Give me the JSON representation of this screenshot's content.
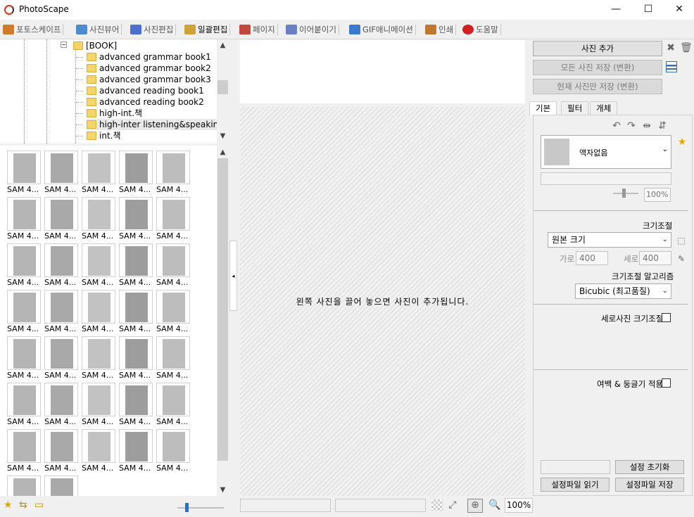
{
  "window": {
    "title": "PhotoScape",
    "minimize": "—",
    "maximize": "☐",
    "close": "✕"
  },
  "menu_tabs": [
    {
      "label": "포토스케이프",
      "color": "#d07a2a"
    },
    {
      "label": "사진뷰어",
      "color": "#4c8bd0"
    },
    {
      "label": "사진편집",
      "color": "#4c6fd0"
    },
    {
      "label": "일괄편집",
      "color": "#d0a23a"
    },
    {
      "label": "페이지",
      "color": "#c0483c"
    },
    {
      "label": "이어붙이기",
      "color": "#6a7fc4"
    },
    {
      "label": "GIF애니메이션",
      "color": "#3a7ad0"
    },
    {
      "label": "인쇄",
      "color": "#c07830"
    },
    {
      "label": "도움말",
      "color": "#d02020"
    }
  ],
  "tree": {
    "root": "[BOOK]",
    "items": [
      "advanced grammar book1",
      "advanced grammar book2",
      "advanced grammar book3",
      "advanced reading book1",
      "advanced reading book2",
      "high-int.책",
      "high-inter listening&speaking",
      "int.책"
    ],
    "selected_index": 6
  },
  "thumbnails": {
    "caption": "SAM 4...",
    "count": 37
  },
  "canvas": {
    "message": "왼쪽 사진을 끌어 놓으면 사진이 추가됩니다."
  },
  "status": {
    "zoom": "100%"
  },
  "right": {
    "add_photo": "사진 추가",
    "save_all": "모든 사진 저장 (변환)",
    "save_current": "현재 사진만 저장 (변환)",
    "tabs": [
      "기본",
      "필터",
      "개체"
    ],
    "frame_value": "액자없음",
    "frame_zoom": "100%",
    "resize_label": "크기조절",
    "resize_value": "원본 크기",
    "width_label": "가로",
    "width_value": "400",
    "height_label": "세로",
    "height_value": "400",
    "algo_label": "크기조절 알고리즘",
    "algo_value": "Bicubic (최고품질)",
    "portrait_resize": "세로사진 크기조절",
    "margin_round": "여백 & 둥글기 적용",
    "reset_settings": "설정 초기화",
    "load_settings": "설정파일 읽기",
    "save_settings": "설정파일 저장"
  }
}
